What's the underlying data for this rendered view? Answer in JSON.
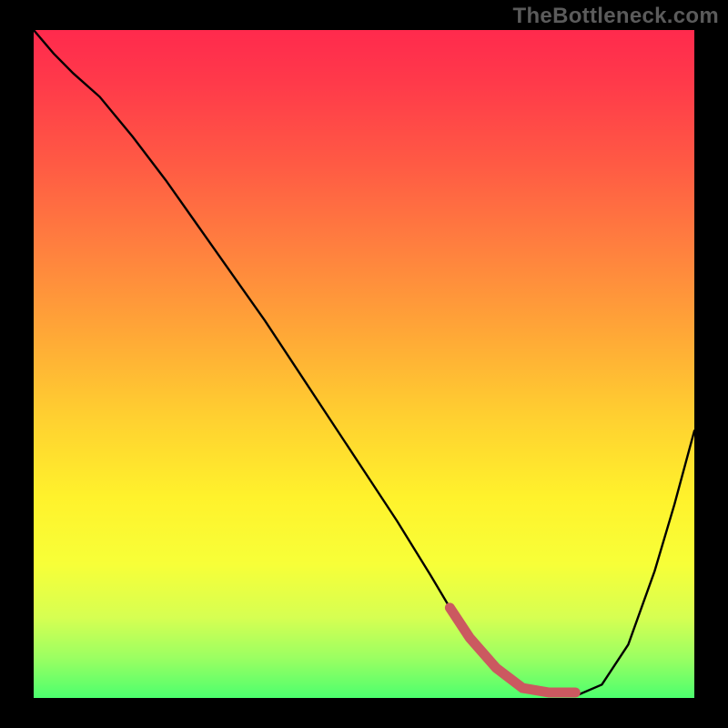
{
  "watermark": "TheBottleneck.com",
  "colors": {
    "background": "#000000",
    "gradient_top": "#ff2a4d",
    "gradient_bottom": "#4cff6e",
    "curve_stroke": "#000000",
    "marker_stroke": "#cb5960"
  },
  "chart_data": {
    "type": "line",
    "title": "",
    "xlabel": "",
    "ylabel": "",
    "xlim": [
      0,
      100
    ],
    "ylim": [
      0,
      100
    ],
    "annotations": [],
    "series": [
      {
        "name": "curve",
        "x": [
          0,
          3,
          6,
          10,
          15,
          20,
          25,
          30,
          35,
          40,
          45,
          50,
          55,
          60,
          63,
          66,
          70,
          74,
          78,
          82,
          86,
          90,
          94,
          97,
          100
        ],
        "y": [
          100,
          96.5,
          93.5,
          90,
          84,
          77.5,
          70.5,
          63.5,
          56.5,
          49,
          41.5,
          34,
          26.5,
          18.5,
          13.5,
          9,
          4.5,
          1.5,
          0.3,
          0.3,
          2,
          8,
          19,
          29,
          40
        ]
      }
    ],
    "marker_segment": {
      "x_start": 63,
      "x_end": 82,
      "description": "highlighted bottom segment near curve minimum"
    }
  }
}
